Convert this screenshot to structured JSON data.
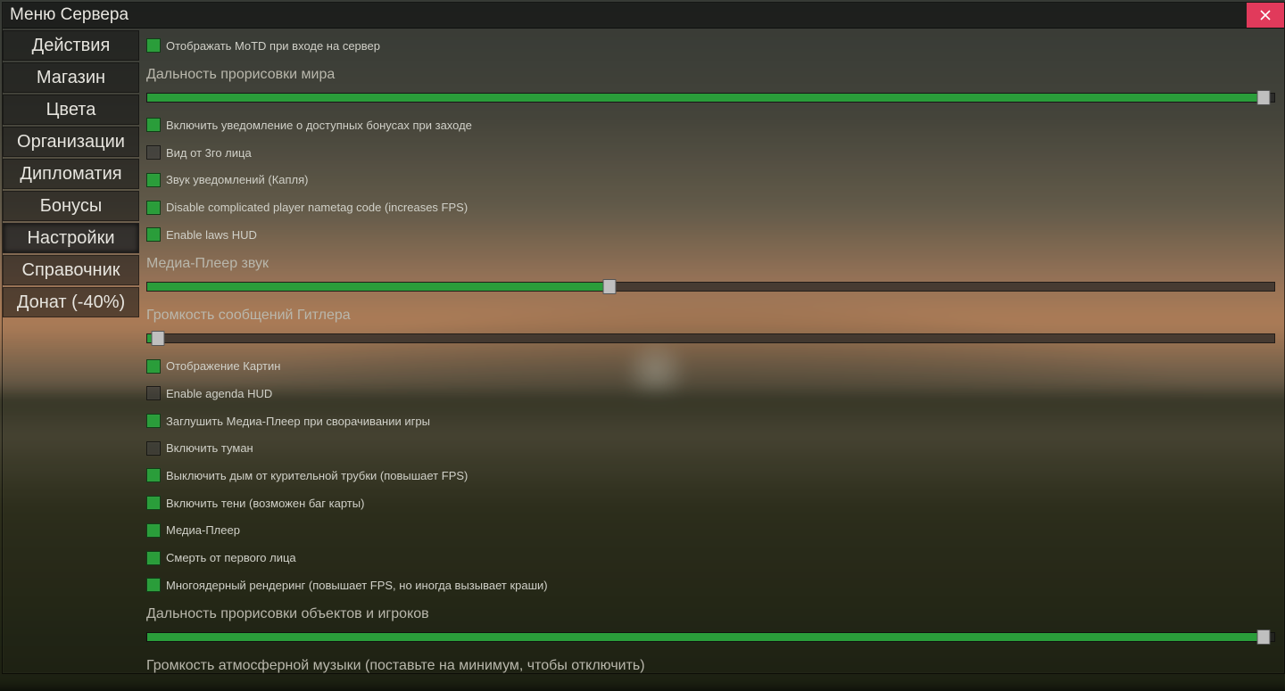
{
  "window": {
    "title": "Меню Сервера"
  },
  "sidebar": {
    "items": [
      {
        "label": "Действия"
      },
      {
        "label": "Магазин"
      },
      {
        "label": "Цвета"
      },
      {
        "label": "Организации"
      },
      {
        "label": "Дипломатия"
      },
      {
        "label": "Бонусы"
      },
      {
        "label": "Настройки",
        "active": true
      },
      {
        "label": "Справочник"
      },
      {
        "label": "Донат (-40%)"
      }
    ]
  },
  "settings": {
    "motd": {
      "label": "Отображать MoTD при входе на сервер",
      "checked": true
    },
    "world_draw": {
      "label": "Дальность прорисовки мира",
      "value": 99
    },
    "bonus_notify": {
      "label": "Включить уведомление о доступных бонусах при заходе",
      "checked": true
    },
    "third_person": {
      "label": "Вид от 3го лица",
      "checked": false
    },
    "notif_sound": {
      "label": "Звук уведомлений (Капля)",
      "checked": true
    },
    "nametag_fps": {
      "label": "Disable complicated player nametag code (increases FPS)",
      "checked": true
    },
    "laws_hud": {
      "label": "Enable laws HUD",
      "checked": true
    },
    "media_volume": {
      "label": "Медиа-Плеер звук",
      "value": 41
    },
    "hitler_volume": {
      "label": "Громкость сообщений Гитлера",
      "value": 1
    },
    "show_paintings": {
      "label": "Отображение Картин",
      "checked": true
    },
    "agenda_hud": {
      "label": "Enable agenda HUD",
      "checked": false
    },
    "mute_media_min": {
      "label": "Заглушить Медиа-Плеер при сворачивании игры",
      "checked": true
    },
    "enable_fog": {
      "label": "Включить туман",
      "checked": false
    },
    "pipe_smoke": {
      "label": "Выключить дым от курительной трубки (повышает FPS)",
      "checked": true
    },
    "shadows": {
      "label": "Включить тени (возможен баг карты)",
      "checked": true
    },
    "media_player": {
      "label": "Медиа-Плеер",
      "checked": true
    },
    "first_person_death": {
      "label": "Смерть от первого лица",
      "checked": true
    },
    "multicore": {
      "label": "Многоядерный рендеринг (повышает FPS, но иногда вызывает краши)",
      "checked": true
    },
    "object_draw": {
      "label": "Дальность прорисовки объектов и игроков",
      "value": 99
    },
    "ambient_volume": {
      "label": "Громкость атмосферной музыки (поставьте на минимум, чтобы отключить)"
    }
  }
}
